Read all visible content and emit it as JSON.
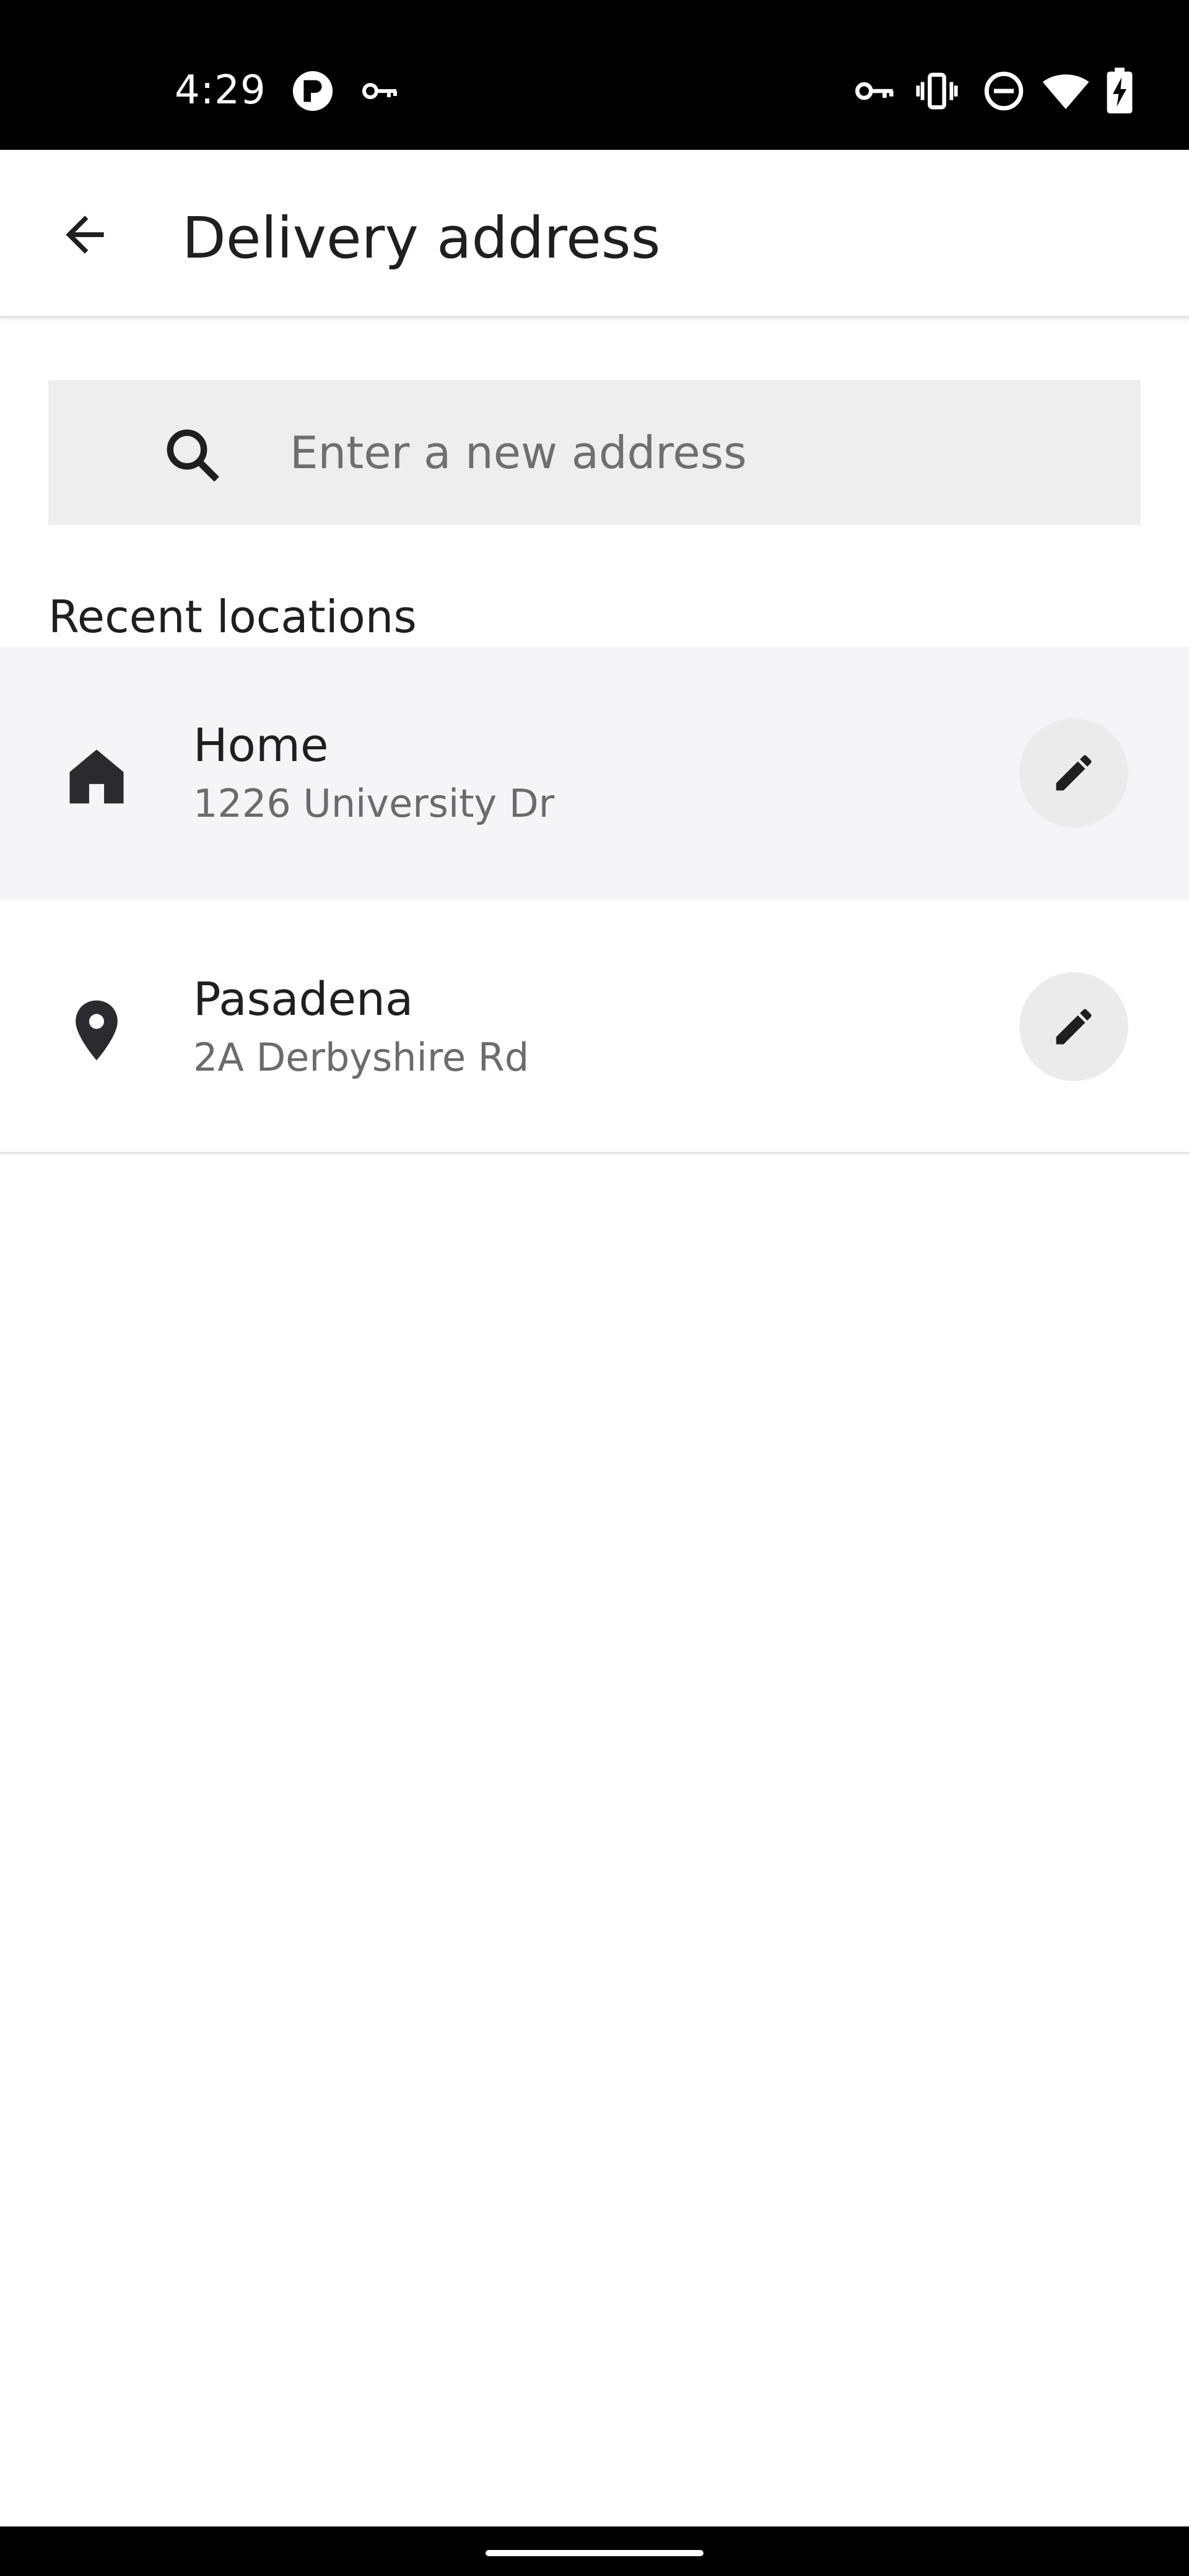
{
  "status_bar": {
    "time": "4:29",
    "icons": [
      "app-notification-icon",
      "vpn-key-icon",
      "key-icon",
      "vibrate-icon",
      "do-not-disturb-icon",
      "wifi-icon",
      "battery-charging-icon"
    ]
  },
  "app_bar": {
    "back_icon": "arrow-left-icon",
    "title": "Delivery address"
  },
  "search": {
    "icon": "search-icon",
    "placeholder": "Enter a new address",
    "value": ""
  },
  "recent": {
    "heading": "Recent locations",
    "items": [
      {
        "icon": "home-icon",
        "title": "Home",
        "subtitle": "1226 University Dr",
        "action_icon": "pencil-icon"
      },
      {
        "icon": "location-pin-icon",
        "title": "Pasadena",
        "subtitle": "2A Derbyshire Rd",
        "action_icon": "pencil-icon"
      }
    ]
  },
  "colors": {
    "status_bar_bg": "#000000",
    "search_bg": "#eeeeee",
    "highlight_row_bg": "#f5f5f7",
    "edit_button_bg": "#ebebeb",
    "primary_text": "#1f1f1f",
    "secondary_text": "#6b6b6b"
  }
}
